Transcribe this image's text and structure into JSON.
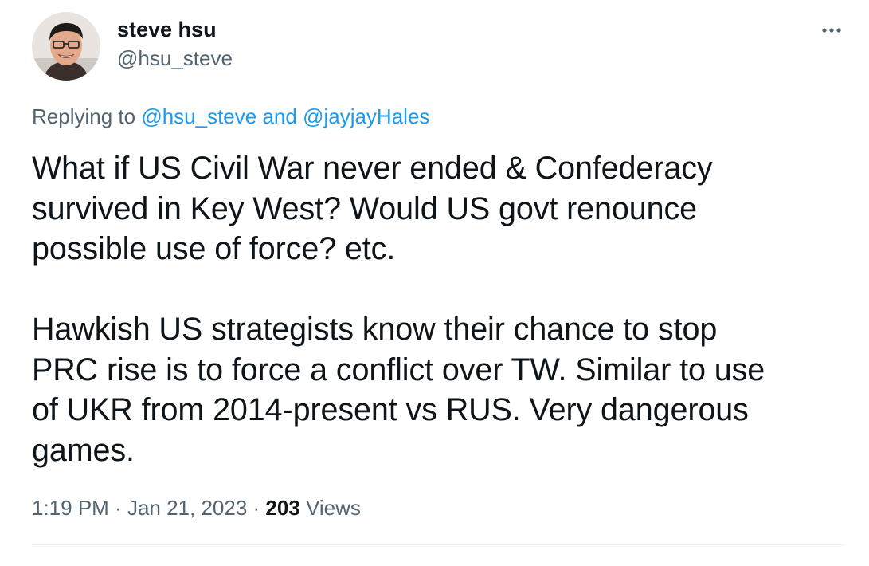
{
  "author": {
    "name": "steve hsu",
    "handle": "@hsu_steve",
    "avatar_icon": "user-avatar-photo"
  },
  "more_menu": {
    "label": "···",
    "icon": "more-horizontal-icon"
  },
  "reply_context": {
    "prefix": "Replying to ",
    "mention_1": "@hsu_steve",
    "conjunction": " and ",
    "mention_2": "@jayjayHales",
    "link_color": "#1d9bf0"
  },
  "tweet": {
    "paragraph_1": "What if US Civil War never ended & Confederacy\nsurvived in Key West? Would US govt renounce\npossible use of force? etc.",
    "paragraph_2": "Hawkish US strategists know their chance to stop\nPRC rise is to force a conflict over TW. Similar to use\nof UKR from 2014-present vs RUS. Very dangerous\ngames."
  },
  "meta": {
    "time": "1:19 PM",
    "separator_1": " · ",
    "date": "Jan 21, 2023",
    "separator_2": " · ",
    "views_count": "203",
    "views_label": " Views"
  },
  "colors": {
    "text_primary": "#0f1419",
    "text_secondary": "#536471",
    "divider": "#eff3f4"
  }
}
